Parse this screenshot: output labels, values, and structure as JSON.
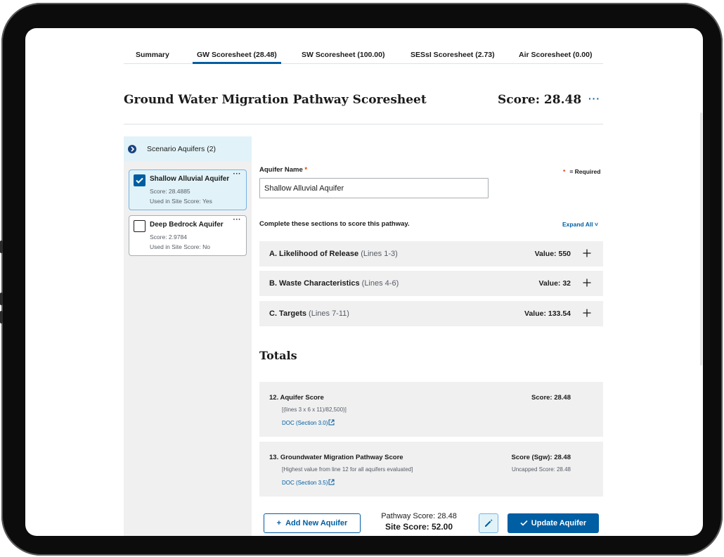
{
  "tabs": [
    {
      "label": "Summary",
      "active": false
    },
    {
      "label": "GW Scoresheet (28.48)",
      "active": true
    },
    {
      "label": "SW Scoresheet (100.00)",
      "active": false
    },
    {
      "label": "SESsI Scoresheet (2.73)",
      "active": false
    },
    {
      "label": "Air Scoresheet (0.00)",
      "active": false
    }
  ],
  "header": {
    "title": "Ground Water Migration Pathway Scoresheet",
    "score": "Score: 28.48",
    "more": "···"
  },
  "sidebar": {
    "title": "Scenario Aquifers (2)",
    "aquifers": [
      {
        "name": "Shallow Alluvial Aquifer",
        "score": "Score: 28.4885",
        "used": "Used in Site Score: Yes",
        "selected": true
      },
      {
        "name": "Deep Bedrock Aquifer",
        "score": "Score: 2.9784",
        "used": "Used in Site Score: No",
        "selected": false
      }
    ],
    "more": "···"
  },
  "form": {
    "label": "Aquifer Name",
    "required_mark": "*",
    "required_note": "= Required",
    "value": "Shallow Alluvial Aquifer",
    "instruction": "Complete these sections to score this pathway.",
    "expand_all": "Expand All ˅"
  },
  "sections": [
    {
      "title": "A. Likelihood of Release",
      "sub": "(Lines 1-3)",
      "value": "Value: 550"
    },
    {
      "title": "B. Waste Characteristics",
      "sub": "(Lines 4-6)",
      "value": "Value: 32"
    },
    {
      "title": "C. Targets",
      "sub": "(Lines 7-11)",
      "value": "Value: 133.54"
    }
  ],
  "totals": {
    "heading": "Totals",
    "items": [
      {
        "title": "12. Aquifer Score",
        "formula": "[(lines 3 x 6 x 11)/82,500)]",
        "doc": "DOC (Section 3.0)",
        "score": "Score: 28.48",
        "uncapped": ""
      },
      {
        "title": "13. Groundwater Migration Pathway Score",
        "formula": "[Highest value from line 12 for all aquifers evaluated]",
        "doc": "DOC (Section 3.5)",
        "score": "Score (Sgw): 28.48",
        "uncapped": "Uncapped Score: 28.48"
      }
    ]
  },
  "footer": {
    "add_label": "Add New Aquifer",
    "pathway_score": "Pathway Score: 28.48",
    "site_score": "Site Score: 52.00",
    "update_label": "Update Aquifer"
  },
  "colors": {
    "primary": "#005ea2",
    "required": "#d54309",
    "panel": "#f0f0f0",
    "selected": "#e1f3f8"
  }
}
